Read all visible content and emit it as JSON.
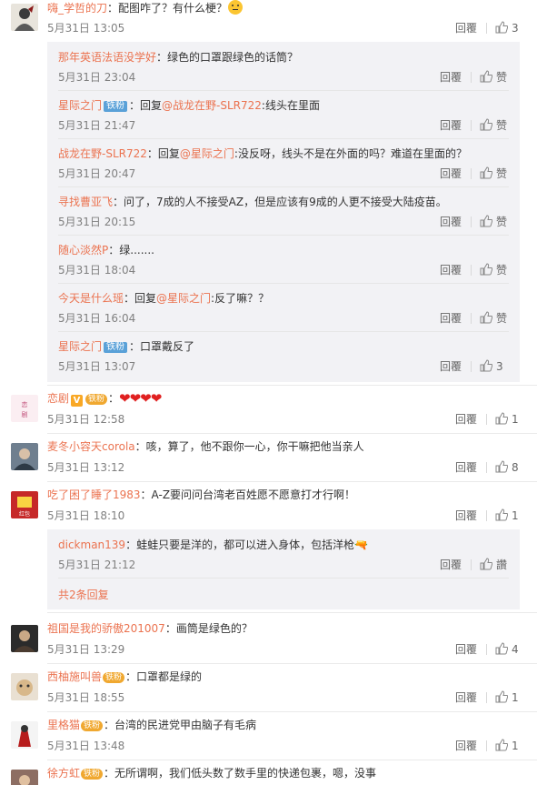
{
  "reply_label": "回覆",
  "like_label": "赞",
  "ellipsis_like_label": "讚",
  "top_comment": {
    "user": "嗨_学哲的刀",
    "text": "：配图咋了？有什么梗？",
    "emoji": "thinking-face",
    "time": "5月31日 13:05",
    "likes": "3"
  },
  "replies": [
    {
      "user": "那年英语法语没学好",
      "text": "：绿色的口罩跟绿色的话筒？",
      "time": "5月31日 23:04",
      "likes": "赞"
    },
    {
      "user": "星际之门",
      "badge": "铁粉",
      "text_pre": "：回复",
      "at": "@战龙在野-SLR722",
      "text_post": ":线头在里面",
      "time": "5月31日 21:47",
      "likes": "赞"
    },
    {
      "user": "战龙在野-SLR722",
      "text_pre": "：回复",
      "at": "@星际之门",
      "text_post": ":没反呀，线头不是在外面的吗？难道在里面的？",
      "time": "5月31日 20:47",
      "likes": "赞"
    },
    {
      "user": "寻找曹亚飞",
      "text": "：问了，7成的人不接受AZ，但是应该有9成的人更不接受大陆疫苗。",
      "time": "5月31日 20:15",
      "likes": "赞"
    },
    {
      "user": "随心淡然P",
      "text": "：绿.......",
      "time": "5月31日 18:04",
      "likes": "赞"
    },
    {
      "user": "今天是什么瑶",
      "text_pre": "：回复",
      "at": "@星际之门",
      "text_post": ":反了嘛？？",
      "time": "5月31日 16:04",
      "likes": "赞"
    },
    {
      "user": "星际之门",
      "badge": "铁粉",
      "text": "：口罩戴反了",
      "time": "5月31日 13:07",
      "likes": "3"
    }
  ],
  "comments": [
    {
      "user": "恋剧",
      "v_badge": "V",
      "fan_badge": "铁粉",
      "hearts": "❤❤❤❤",
      "time": "5月31日 12:58",
      "likes": "1"
    },
    {
      "user": "麦冬小容天corola",
      "text": "：咳，算了，他不跟你一心，你干嘛把他当亲人",
      "time": "5月31日 13:12",
      "likes": "8"
    },
    {
      "user": "吃了困了睡了1983",
      "text": "：A-Z要问问台湾老百姓愿不愿意打才行啊！",
      "time": "5月31日 18:10",
      "likes": "1"
    },
    {
      "user": "祖国是我的骄傲201007",
      "text": "：画筒是绿色的？",
      "time": "5月31日 13:29",
      "likes": "4"
    },
    {
      "user": "西柚施叫兽",
      "fan_badge": "铁粉",
      "text": "：口罩都是绿的",
      "time": "5月31日 18:55",
      "likes": "1"
    },
    {
      "user": "里格猫",
      "fan_badge": "铁粉",
      "text": "：台湾的民进党甲由脑子有毛病",
      "time": "5月31日 13:48",
      "likes": "1"
    },
    {
      "user": "徐方虹",
      "fan_badge": "铁粉",
      "text": "：无所谓啊，我们低头数了数手里的快递包裹，嗯，没事"
    }
  ],
  "sub_reply": {
    "user": "dickman139",
    "text": "：蛙蛙只要是洋的，都可以进入身体，包括洋枪",
    "gun": "🔫",
    "time": "5月31日 21:12",
    "likes": "讚"
  },
  "more_replies": "共2条回复",
  "colors": {
    "username": "#eb7350",
    "reply_bg": "#f2f2f5",
    "time": "#808080"
  }
}
